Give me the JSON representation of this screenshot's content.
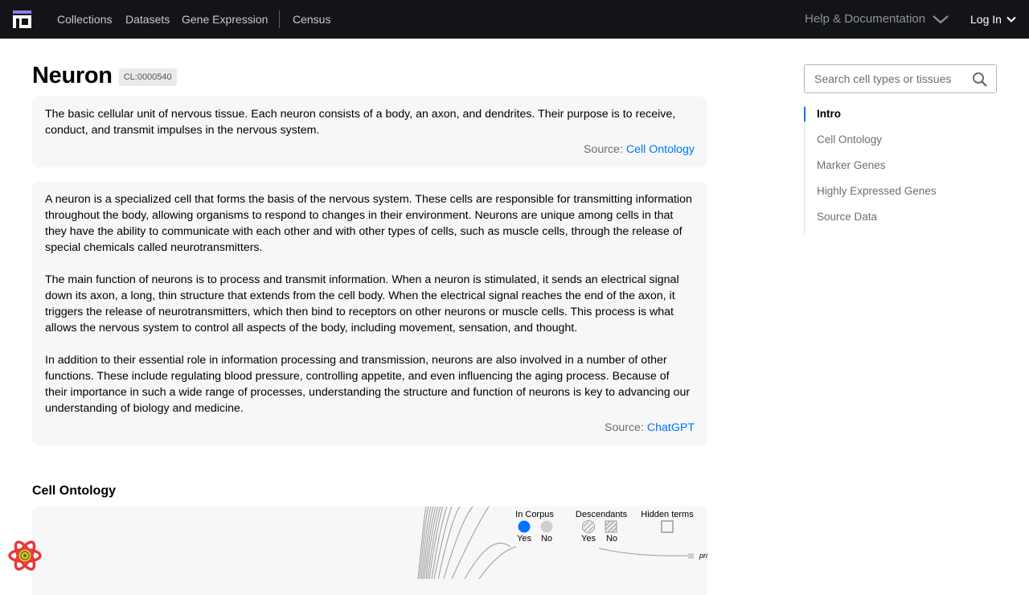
{
  "nav": {
    "links": [
      "Collections",
      "Datasets",
      "Gene Expression",
      "Census"
    ],
    "help_label": "Help & Documentation",
    "login_label": "Log In"
  },
  "page": {
    "title": "Neuron",
    "cl_id": "CL:0000540"
  },
  "description_ontology": {
    "text": "The basic cellular unit of nervous tissue. Each neuron consists of a body, an axon, and dendrites. Their purpose is to receive, conduct, and transmit impulses in the nervous system.",
    "source_label": "Source:",
    "source_link": "Cell Ontology"
  },
  "description_gpt": {
    "paragraphs": [
      "A neuron is a specialized cell that forms the basis of the nervous system. These cells are responsible for transmitting information throughout the body, allowing organisms to respond to changes in their environment. Neurons are unique among cells in that they have the ability to communicate with each other and with other types of cells, such as muscle cells, through the release of special chemicals called neurotransmitters.",
      "The main function of neurons is to process and transmit information. When a neuron is stimulated, it sends an electrical signal down its axon, a long, thin structure that extends from the cell body. When the electrical signal reaches the end of the axon, it triggers the release of neurotransmitters, which then bind to receptors on other neurons or muscle cells. This process is what allows the nervous system to control all aspects of the body, including movement, sensation, and thought.",
      "In addition to their essential role in information processing and transmission, neurons are also involved in a number of other functions. These include regulating blood pressure, controlling appetite, and even influencing the aging process. Because of their importance in such a wide range of processes, understanding the structure and function of neurons is key to advancing our understanding of biology and medicine."
    ],
    "source_label": "Source:",
    "source_link": "ChatGPT"
  },
  "cell_ontology": {
    "section_title": "Cell Ontology",
    "legend": {
      "in_corpus": "In Corpus",
      "descendants": "Descendants",
      "hidden_terms": "Hidden terms",
      "yes": "Yes",
      "no": "No"
    },
    "node_label_partial": "pri"
  },
  "search": {
    "placeholder": "Search cell types or tissues"
  },
  "toc": {
    "items": [
      "Intro",
      "Cell Ontology",
      "Marker Genes",
      "Highly Expressed Genes",
      "Source Data"
    ]
  },
  "colors": {
    "nav_bg": "#121417",
    "accent": "#0073ff",
    "card_bg": "#f7f7f7"
  }
}
